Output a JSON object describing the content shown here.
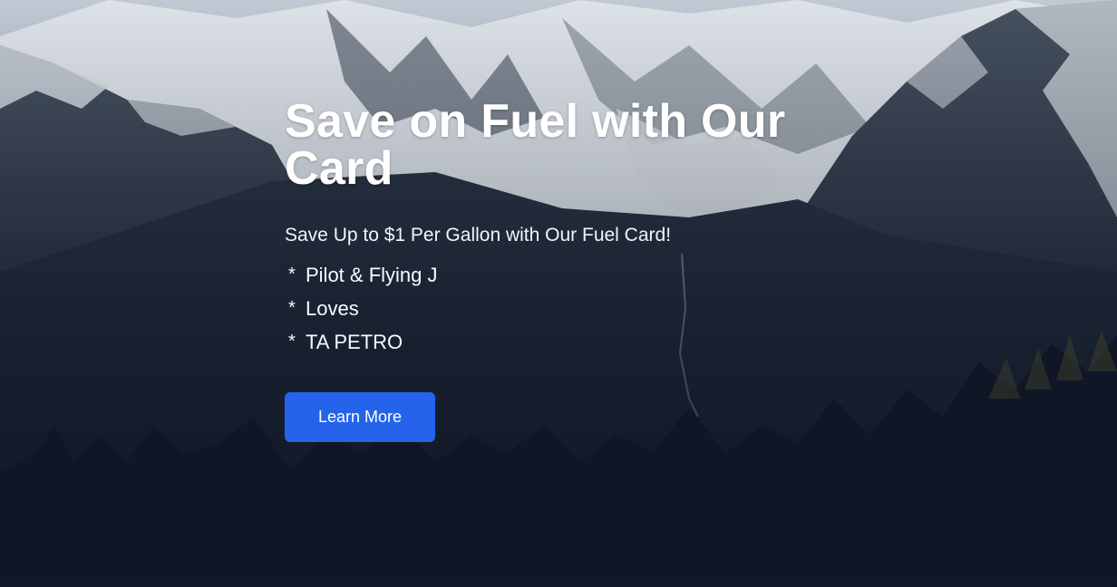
{
  "hero": {
    "title": "Save on Fuel with Our Card",
    "subtitle": "Save Up to $1 Per Gallon with Our Fuel Card!",
    "bullet_symbol": "*",
    "stations": [
      "Pilot & Flying J",
      "Loves",
      "TA PETRO"
    ],
    "cta_label": "Learn More"
  },
  "colors": {
    "accent": "#2563eb",
    "text": "#ffffff",
    "background_dark": "#111827"
  }
}
